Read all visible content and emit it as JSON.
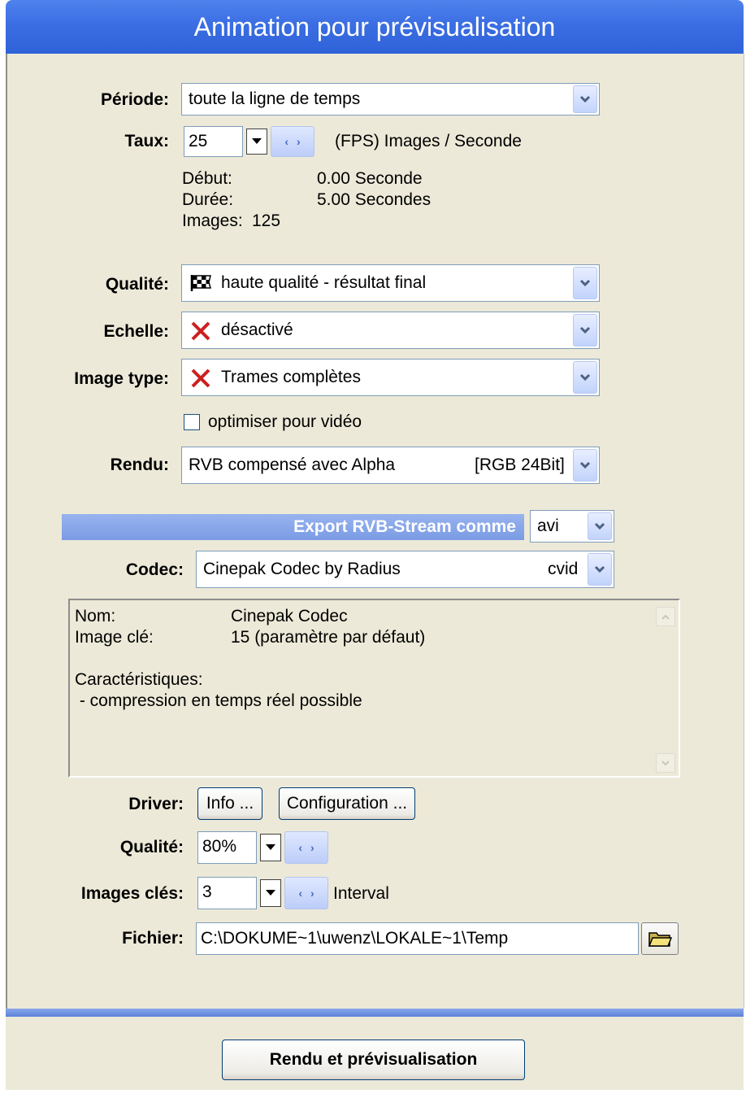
{
  "window": {
    "title": "Animation pour prévisualisation"
  },
  "periode": {
    "label": "Période:",
    "value": "toute la ligne de temps"
  },
  "taux": {
    "label": "Taux:",
    "value": "25",
    "unit": "(FPS) Images / Seconde"
  },
  "timing": {
    "debut_label": "Début:",
    "debut_value": "0.00 Seconde",
    "duree_label": "Durée:",
    "duree_value": "5.00 Secondes",
    "images_label": "Images:",
    "images_value": "125"
  },
  "qualite": {
    "label": "Qualité:",
    "value": "haute qualité - résultat final",
    "icon": "checkered-flag-icon"
  },
  "echelle": {
    "label": "Echelle:",
    "value": "désactivé",
    "icon": "red-x-icon"
  },
  "image_type": {
    "label": "Image type:",
    "value": "Trames complètes",
    "icon": "red-x-icon"
  },
  "optimiser": {
    "label": "optimiser pour vidéo",
    "checked": false
  },
  "rendu": {
    "label": "Rendu:",
    "value": "RVB compensé avec Alpha",
    "format": "[RGB 24Bit]"
  },
  "export": {
    "label": "Export RVB-Stream comme",
    "value": "avi"
  },
  "codec": {
    "label": "Codec:",
    "value": "Cinepak Codec by Radius",
    "fourcc": "cvid"
  },
  "codec_info": {
    "nom_label": "Nom:",
    "nom_value": "Cinepak Codec",
    "image_cle_label": "Image clé:",
    "image_cle_value": "15 (paramètre par défaut)",
    "caracteristiques_label": "Caractéristiques:",
    "caracteristiques_item": " - compression en temps réel possible"
  },
  "driver": {
    "label": "Driver:",
    "info_button": "Info ...",
    "config_button": "Configuration ..."
  },
  "codec_qualite": {
    "label": "Qualité:",
    "value": "80%"
  },
  "images_cles": {
    "label": "Images clés:",
    "value": "3",
    "suffix": "Interval"
  },
  "fichier": {
    "label": "Fichier:",
    "value": "C:\\DOKUME~1\\uwenz\\LOKALE~1\\Temp"
  },
  "footer": {
    "render_button": "Rendu et prévisualisation"
  },
  "colors": {
    "title_bar": "#3b6ee3",
    "panel": "#ece9d8",
    "accent": "#7f9db9",
    "x_red": "#cc2020"
  }
}
